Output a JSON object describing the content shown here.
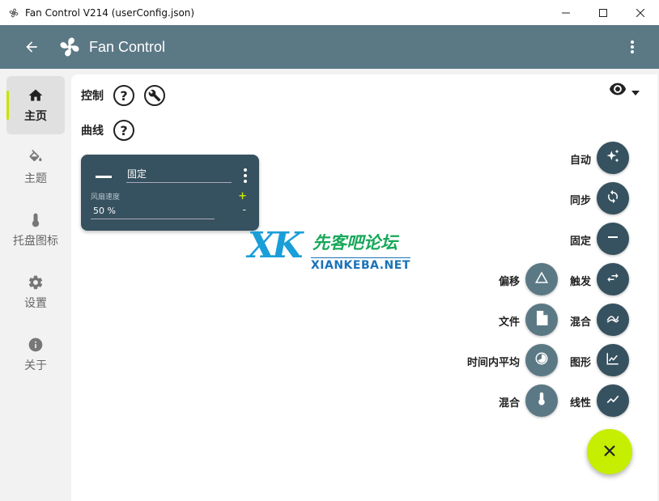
{
  "window": {
    "title": "Fan Control V214 (userConfig.json)"
  },
  "header": {
    "title": "Fan Control"
  },
  "sidebar": {
    "items": [
      {
        "label": "主页",
        "icon": "home-icon",
        "active": true
      },
      {
        "label": "主题",
        "icon": "paint-bucket-icon",
        "active": false
      },
      {
        "label": "托盘图标",
        "icon": "thermometer-icon",
        "active": false
      },
      {
        "label": "设置",
        "icon": "gear-icon",
        "active": false
      },
      {
        "label": "关于",
        "icon": "info-icon",
        "active": false
      }
    ]
  },
  "main": {
    "controls_label": "控制",
    "curves_label": "曲线",
    "card": {
      "name": "固定",
      "field_label": "风扇速度",
      "value": "50 %",
      "plus": "+",
      "minus": "-"
    }
  },
  "watermark": {
    "logo": "XK",
    "cn": "先客吧论坛",
    "en": "XIANKEBA.NET"
  },
  "fab_menu": {
    "right": [
      {
        "label": "自动",
        "icon": "sparkles-icon"
      },
      {
        "label": "同步",
        "icon": "sync-icon"
      },
      {
        "label": "固定",
        "icon": "minus-icon"
      },
      {
        "label": "触发",
        "icon": "swap-icon"
      },
      {
        "label": "混合",
        "icon": "mix-chart-icon"
      },
      {
        "label": "图形",
        "icon": "line-chart-icon"
      },
      {
        "label": "线性",
        "icon": "trend-icon"
      }
    ],
    "left": [
      {
        "label": "偏移",
        "icon": "triangle-icon"
      },
      {
        "label": "文件",
        "icon": "file-icon"
      },
      {
        "label": "时间内平均",
        "icon": "clock-pie-icon"
      },
      {
        "label": "混合",
        "icon": "thermometer-icon"
      }
    ],
    "close_icon": "close-icon"
  },
  "colors": {
    "appbar": "#5b7885",
    "card": "#36515f",
    "accent": "#c6ee00"
  }
}
